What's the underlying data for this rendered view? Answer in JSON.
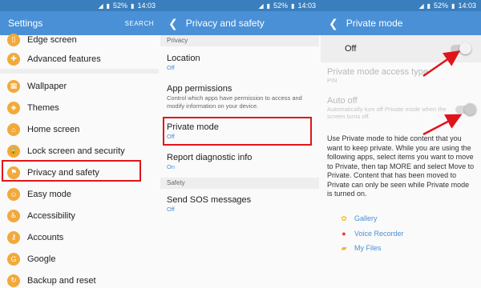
{
  "status_bar": {
    "battery": "52%",
    "time": "14:03"
  },
  "settings": {
    "title": "Settings",
    "search": "SEARCH",
    "items": [
      {
        "label": "Edge screen",
        "icon": "edge-screen-icon",
        "glyph": "▯"
      },
      {
        "label": "Advanced features",
        "icon": "advanced-features-icon",
        "glyph": "✚"
      },
      {
        "label": "Wallpaper",
        "icon": "wallpaper-icon",
        "glyph": "▦"
      },
      {
        "label": "Themes",
        "icon": "themes-icon",
        "glyph": "◈"
      },
      {
        "label": "Home screen",
        "icon": "home-screen-icon",
        "glyph": "⌂"
      },
      {
        "label": "Lock screen and security",
        "icon": "lock-icon",
        "glyph": "🔒"
      },
      {
        "label": "Privacy and safety",
        "icon": "privacy-icon",
        "glyph": "⚑"
      },
      {
        "label": "Easy mode",
        "icon": "easy-mode-icon",
        "glyph": "☺"
      },
      {
        "label": "Accessibility",
        "icon": "accessibility-icon",
        "glyph": "♿"
      },
      {
        "label": "Accounts",
        "icon": "accounts-icon",
        "glyph": "⚷"
      },
      {
        "label": "Google",
        "icon": "google-icon",
        "glyph": "G"
      },
      {
        "label": "Backup and reset",
        "icon": "backup-icon",
        "glyph": "↻"
      }
    ]
  },
  "privacy": {
    "title": "Privacy and safety",
    "section_privacy": "Privacy",
    "location": {
      "title": "Location",
      "value": "Off"
    },
    "app_permissions": {
      "title": "App permissions",
      "desc": "Control which apps have permission to access and modify information on your device."
    },
    "private_mode": {
      "title": "Private mode",
      "value": "Off"
    },
    "report": {
      "title": "Report diagnostic info",
      "value": "On"
    },
    "section_safety": "Safety",
    "sos": {
      "title": "Send SOS messages",
      "value": "Off"
    }
  },
  "private_mode": {
    "title": "Private mode",
    "switch_label": "Off",
    "access_type": {
      "title": "Private mode access type",
      "value": "PIN"
    },
    "auto_off": {
      "title": "Auto off",
      "desc": "Automatically turn off Private mode when the screen turns off."
    },
    "description": "Use Private mode to hide content that you want to keep private. While you are using the following apps, select items you want to move to Private, then tap MORE and select Move to Private. Content that has been moved to Private can only be seen while Private mode is turned on.",
    "apps": [
      {
        "label": "Gallery",
        "icon": "gallery-icon",
        "glyph": "✿",
        "color": "#f4c21a"
      },
      {
        "label": "Voice Recorder",
        "icon": "voice-recorder-icon",
        "glyph": "●",
        "color": "#e53935"
      },
      {
        "label": "My Files",
        "icon": "my-files-icon",
        "glyph": "▰",
        "color": "#f2b33d"
      }
    ]
  },
  "colors": {
    "accent": "#4a90d6",
    "status": "#3a7ebd",
    "highlight": "#e0151b",
    "icon": "#f2a93b"
  }
}
